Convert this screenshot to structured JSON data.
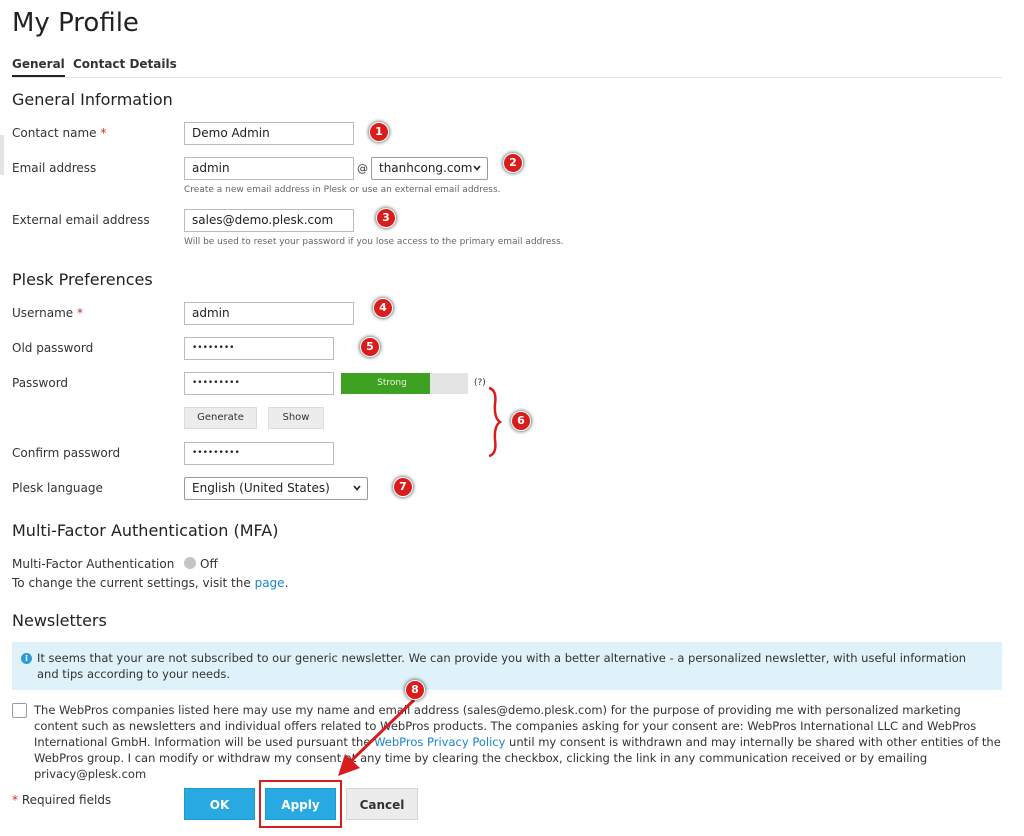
{
  "page": {
    "title": "My Profile"
  },
  "tabs": [
    {
      "label": "General",
      "active": true
    },
    {
      "label": "Contact Details",
      "active": false
    }
  ],
  "general": {
    "title": "General Information",
    "contact_name": {
      "label": "Contact name",
      "required_mark": "*",
      "value": "Demo Admin"
    },
    "email": {
      "label": "Email address",
      "value": "admin",
      "at": "@",
      "domain": "thanhcong.com",
      "hint": "Create a new email address in Plesk or use an external email address."
    },
    "external_email": {
      "label": "External email address",
      "value": "sales@demo.plesk.com",
      "hint": "Will be used to reset your password if you lose access to the primary email address."
    }
  },
  "prefs": {
    "title": "Plesk Preferences",
    "username": {
      "label": "Username",
      "required_mark": "*",
      "value": "admin"
    },
    "old_password": {
      "label": "Old password",
      "value": "••••••••"
    },
    "password": {
      "label": "Password",
      "value": "•••••••••",
      "strength_label": "Strong",
      "strength_fraction": 0.7,
      "help": "(?)"
    },
    "generate_label": "Generate",
    "show_label": "Show",
    "confirm_password": {
      "label": "Confirm password",
      "value": "•••••••••"
    },
    "language": {
      "label": "Plesk language",
      "value": "English (United States)"
    }
  },
  "mfa": {
    "title": "Multi-Factor Authentication (MFA)",
    "label": "Multi-Factor Authentication",
    "status": "Off",
    "note_prefix": "To change the current settings, visit the ",
    "note_link": "page",
    "note_suffix": "."
  },
  "newsletters": {
    "title": "Newsletters",
    "info": "It seems that your are not subscribed to our generic newsletter. We can provide you with a better alternative - a personalized newsletter, with useful information and tips according to your needs.",
    "consent_part1": "The WebPros companies listed here may use my name and email address (sales@demo.plesk.com) for the purpose of providing me with personalized marketing content such as newsletters and individual offers related to WebPros products. The companies asking for your consent are: WebPros International LLC and WebPros International GmbH. Information will be used pursuant the ",
    "consent_link": "WebPros Privacy Policy",
    "consent_part2": " until my consent is withdrawn and may internally be shared with other entities of the WebPros group. I can modify or withdraw my consent at any time by clearing the checkbox, clicking the link in any communication received or by emailing privacy@plesk.com"
  },
  "footer": {
    "required_mark": "*",
    "required_note": " Required fields",
    "ok_label": "OK",
    "apply_label": "Apply",
    "cancel_label": "Cancel"
  },
  "annotations": {
    "badges": [
      "1",
      "2",
      "3",
      "4",
      "5",
      "6",
      "7",
      "8"
    ],
    "color": "#d91c1c"
  },
  "colors": {
    "accent": "#28a9e1",
    "strength": "#3ea121",
    "info_bg": "#dff1f9",
    "annotation": "#d91c1c"
  }
}
